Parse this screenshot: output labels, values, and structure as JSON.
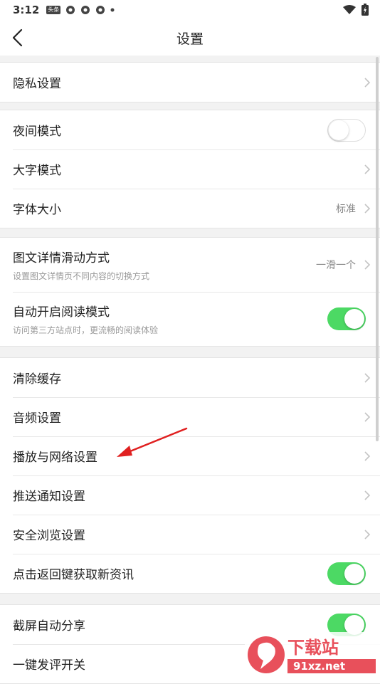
{
  "status_bar": {
    "time": "3:12",
    "badge_text": "头条"
  },
  "navbar": {
    "title": "设置"
  },
  "groups": [
    {
      "items": [
        {
          "label": "隐私设置"
        }
      ]
    },
    {
      "items": [
        {
          "label": "夜间模式",
          "toggle": "off"
        },
        {
          "label": "大字模式"
        },
        {
          "label": "字体大小",
          "value": "标准"
        }
      ]
    },
    {
      "items": [
        {
          "label": "图文详情滑动方式",
          "sub": "设置图文详情页不同内容的切换方式",
          "value": "一滑一个"
        },
        {
          "label": "自动开启阅读模式",
          "sub": "访问第三方站点时，更流畅的阅读体验",
          "toggle": "on"
        }
      ]
    },
    {
      "items": [
        {
          "label": "清除缓存"
        },
        {
          "label": "音频设置"
        },
        {
          "label": "播放与网络设置"
        },
        {
          "label": "推送通知设置"
        },
        {
          "label": "安全浏览设置"
        },
        {
          "label": "点击返回键获取新资讯",
          "toggle": "on"
        }
      ]
    },
    {
      "items": [
        {
          "label": "截屏自动分享",
          "toggle": "on"
        },
        {
          "label": "一键发评开关"
        }
      ]
    }
  ],
  "watermark": {
    "text": "下载站",
    "site": "91xz.net"
  },
  "colors": {
    "toggle_on": "#4cd964",
    "arrow": "#e02020"
  }
}
